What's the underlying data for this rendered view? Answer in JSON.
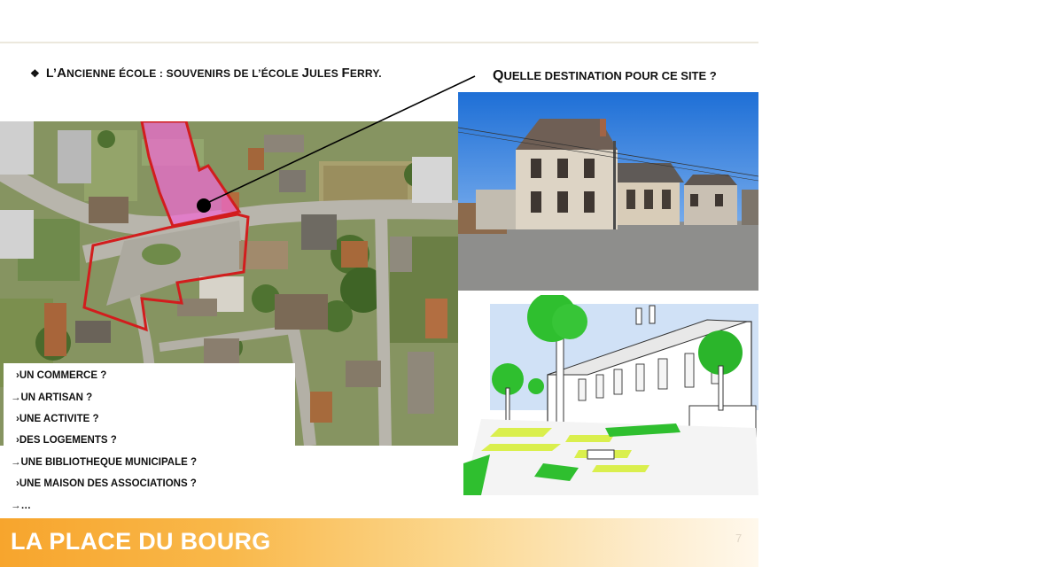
{
  "header": {
    "bullet_icon": "four-diamond-bullet-icon",
    "title_lead": "L’",
    "title_a": "A",
    "title_b": "NCIENNE ÉCOLE : SOUVENIRS DE L’ÉCOLE ",
    "title_c": "J",
    "title_d": "ULES ",
    "title_e": "F",
    "title_f": "ERRY."
  },
  "question": {
    "q_a": "Q",
    "q_b": "UELLE DESTINATION POUR CE SITE ?"
  },
  "options": [
    {
      "arrow": "›",
      "label": "UN COMMERCE ?"
    },
    {
      "arrow": "→",
      "label": "UN ARTISAN ?"
    },
    {
      "arrow": "›",
      "label": "UNE ACTIVITE ?"
    },
    {
      "arrow": "›",
      "label": "DES LOGEMENTS ?"
    },
    {
      "arrow": "→",
      "label": "UNE BIBLIOTHEQUE MUNICIPALE ?"
    },
    {
      "arrow": "›",
      "label": "UNE MAISON DES ASSOCIATIONS ?"
    },
    {
      "arrow": "→",
      "label": "…"
    }
  ],
  "footer": {
    "title": "LA PLACE DU BOURG",
    "page_number": "7"
  },
  "colors": {
    "accent": "#f7a52d",
    "site_outline": "#d21d1d",
    "site_fill": "#f06ad2",
    "sketch_green": "#2fbf2f"
  }
}
